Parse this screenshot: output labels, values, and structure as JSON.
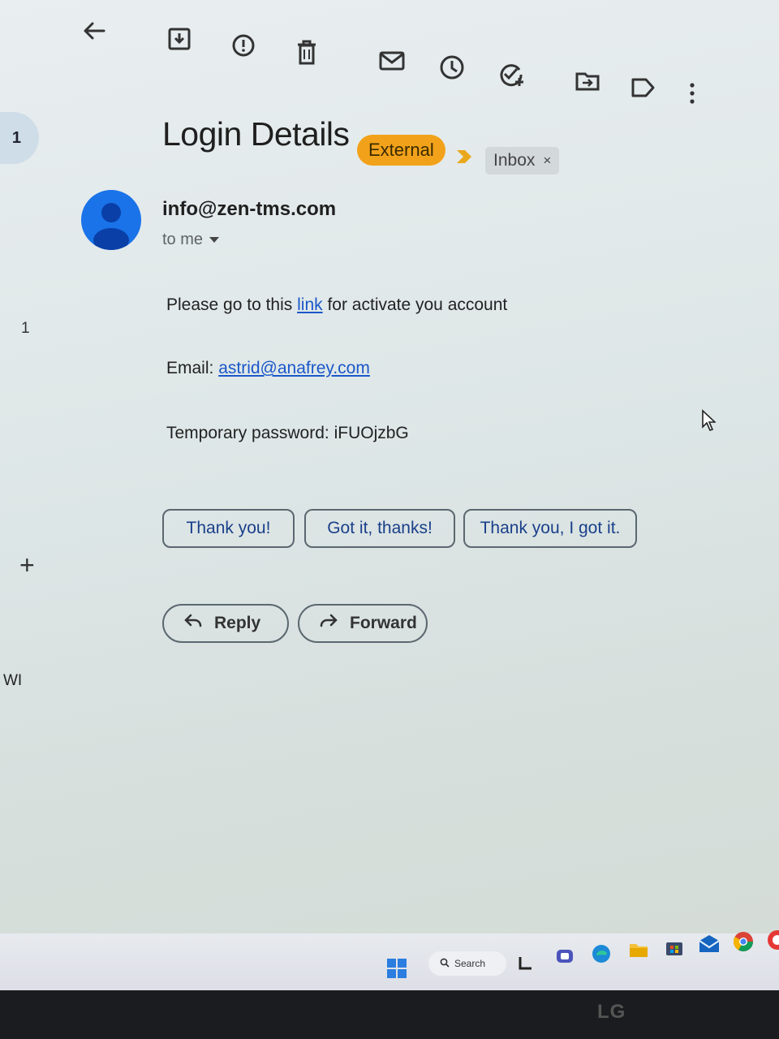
{
  "left_rail": {
    "badge_count": "1",
    "count": "1",
    "plus": "+",
    "partial_label": "WI"
  },
  "toolbar": {
    "icons": [
      "back-arrow-icon",
      "archive-icon",
      "report-spam-icon",
      "delete-icon",
      "mark-unread-icon",
      "snooze-icon",
      "add-task-icon",
      "move-to-icon",
      "label-icon",
      "more-options-icon"
    ]
  },
  "email": {
    "subject": "Login Details",
    "labels": {
      "external": "External",
      "inbox": "Inbox",
      "remove_inbox": "×"
    },
    "sender": "info@zen-tms.com",
    "recipient": "to me",
    "body": {
      "line1_before": "Please go to this ",
      "line1_link": "link",
      "line1_after": " for activate you account",
      "email_label": "Email: ",
      "email_value": "astrid@anafrey.com",
      "password_label": "Temporary password: ",
      "password_value": "iFUOjzbG"
    },
    "smart_replies": [
      "Thank you!",
      "Got it, thanks!",
      "Thank you, I got it."
    ],
    "actions": {
      "reply": "Reply",
      "forward": "Forward"
    }
  },
  "taskbar": {
    "search_placeholder": "Search"
  },
  "monitor": {
    "brand": "LG"
  },
  "colors": {
    "external_chip": "#f2a21a",
    "link": "#1a57c9",
    "avatar": "#1a73e8"
  }
}
